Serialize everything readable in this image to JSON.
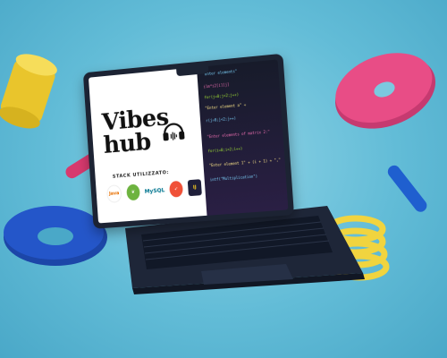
{
  "screen": {
    "brand_line1": "Vibes",
    "brand_line2": "hub",
    "stack_label": "STACK UTILIZZATO:",
    "technologies": [
      {
        "name": "java",
        "label": "Java",
        "icon": "java-icon"
      },
      {
        "name": "spring",
        "label": "",
        "icon": "spring-icon"
      },
      {
        "name": "mysql",
        "label": "MySQL",
        "icon": "mysql-icon"
      },
      {
        "name": "swift",
        "label": "",
        "icon": "swift-icon"
      },
      {
        "name": "intellij",
        "label": "IJ",
        "icon": "intellij-icon"
      }
    ],
    "code_lines": [
      "\"Enter elements\"",
      "ilm*i2[i][j]",
      "for(j=0;j<2;j++)",
      "\"Enter element a\" +",
      "r(j=0;j<2;j++)",
      "\"Enter elements of matrix 2:\"",
      "for(i=0;i<2;i++)",
      "\"Enter element 1\" + (i + 1) + \",\"",
      "intf(\"Multiplication\")"
    ]
  },
  "colors": {
    "background": "#62bcd7",
    "cylinder_yellow": "#f2d43b",
    "ring_pink": "#e84d86",
    "ring_blue": "#2456c9",
    "stick_pink": "#d8396e",
    "stick_blue": "#1f5fcf",
    "spring_yellow": "#f1d43f"
  }
}
